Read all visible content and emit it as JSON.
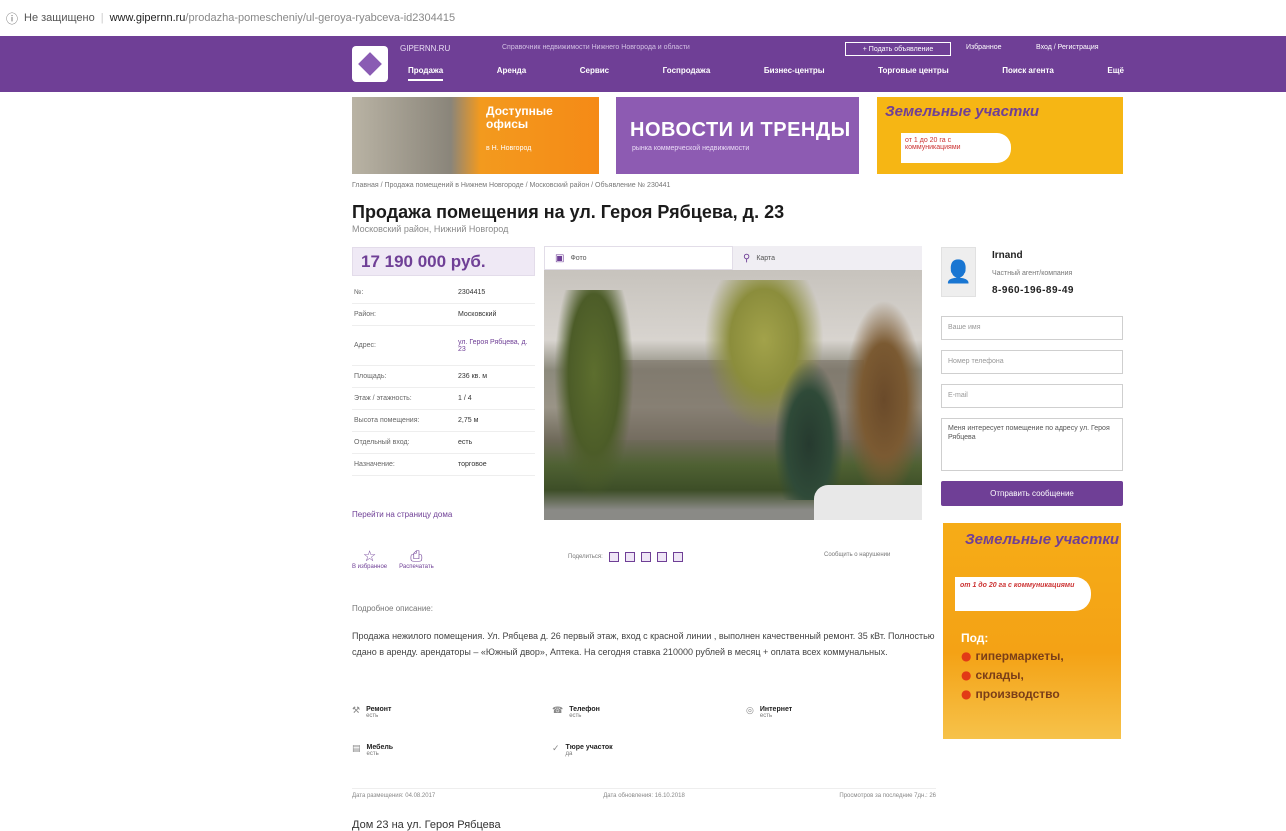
{
  "browser": {
    "security": "Не защищено",
    "domain": "www.gipernn.ru",
    "path": "/prodazha-pomescheniy/ul-geroya-ryabceva-id2304415"
  },
  "header": {
    "site_name": "GIPERNN.RU",
    "tagline": "Справочник недвижимости Нижнего Новгорода и области",
    "add_button": "+ Подать объявление",
    "favorites": "Избранное",
    "login": "Вход / Регистрация",
    "menu": [
      "Продажа",
      "Аренда",
      "Сервис",
      "Госпродажа",
      "Бизнес-центры",
      "Торговые центры",
      "Поиск агента",
      "Ещё"
    ]
  },
  "banners": {
    "offices": {
      "title": "Доступные офисы",
      "sub": "в Н. Новгород"
    },
    "news": {
      "title": "НОВОСТИ И ТРЕНДЫ",
      "sub": "рынка коммерческой недвижимости"
    },
    "land": {
      "title": "Земельные участки",
      "sub": "от 1 до 20 га с коммуникациями"
    }
  },
  "breadcrumb": "Главная / Продажа помещений в Нижнем Новгороде / Московский район / Объявление № 230441",
  "listing": {
    "title": "Продажа помещения на ул. Героя Рябцева, д. 23",
    "subtitle": "Московский район, Нижний Новгород",
    "price": "17 190 000 руб.",
    "facts": [
      {
        "key": "№:",
        "value": "2304415"
      },
      {
        "key": "Район:",
        "value": "Московский"
      },
      {
        "key": "Адрес:",
        "value": "ул. Героя Рябцева, д. 23"
      },
      {
        "key": "Площадь:",
        "value": "236 кв. м"
      },
      {
        "key": "Этаж / этажность:",
        "value": "1 / 4"
      },
      {
        "key": "Высота помещения:",
        "value": "2,75 м"
      },
      {
        "key": "Отдельный вход:",
        "value": "есть"
      },
      {
        "key": "Назначение:",
        "value": "торговое"
      }
    ],
    "house_link": "Перейти на страницу дома",
    "tabs": {
      "photo": "Фото",
      "map": "Карта"
    },
    "actions": {
      "favorite": "В избранное",
      "print": "Распечатать"
    },
    "share_label": "Поделиться:",
    "report": "Сообщить о нарушении",
    "description_title": "Подробное описание:",
    "description": "Продажа нежилого помещения. Ул. Рябцева д. 26 первый этаж, вход с красной линии , выполнен качественный ремонт. 35 кВт. Полностью сдано в аренду. арендаторы – «Южный двор», Аптека. На сегодня ставка 210000 рублей в месяц + оплата всех коммунальных.",
    "features": [
      {
        "icon": "repair-icon",
        "label": "Ремонт",
        "value": "есть"
      },
      {
        "icon": "phone-icon",
        "label": "Телефон",
        "value": "есть"
      },
      {
        "icon": "internet-icon",
        "label": "Интернет",
        "value": "есть"
      },
      {
        "icon": "furniture-icon",
        "label": "Мебель",
        "value": "есть"
      },
      {
        "icon": "land-icon",
        "label": "Тюре участок",
        "value": "да"
      }
    ],
    "meta": {
      "placed": "Дата размещения: 04.08.2017",
      "updated": "Дата обновления: 16.10.2018",
      "views": "Просмотров за последние 7дн.: 26"
    },
    "house_title": "Дом 23 на ул. Героя Рябцева"
  },
  "agent": {
    "name": "Irnand",
    "role": "Частный агент/компания",
    "phone": "8-960-196-89-49"
  },
  "contact_form": {
    "name_placeholder": "Ваше имя",
    "phone_placeholder": "Номер телефона",
    "email_placeholder": "E-mail",
    "message": "Меня интересует помещение по адресу ул. Героя Рябцева",
    "send": "Отправить сообщение"
  },
  "side_ad": {
    "title": "Земельные участки",
    "sub": "от 1 до 20 га с коммуникациями",
    "for": "Под:",
    "items": [
      "гипермаркеты,",
      "склады,",
      "производство"
    ]
  }
}
